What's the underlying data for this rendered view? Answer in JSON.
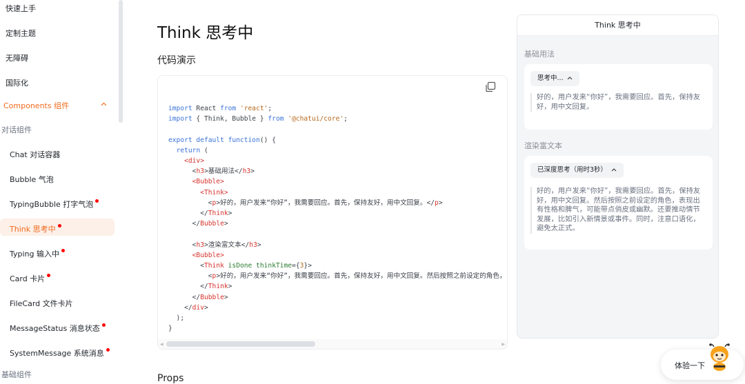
{
  "sidebar": {
    "items_top": [
      "快速上手",
      "定制主题",
      "无障碍",
      "国际化"
    ],
    "components_label": "Components 组件",
    "groups": [
      "对话组件",
      "基础组件"
    ],
    "dialog_items": [
      {
        "label": "Chat 对话容器",
        "dot": false
      },
      {
        "label": "Bubble 气泡",
        "dot": false
      },
      {
        "label": "TypingBubble 打字气泡",
        "dot": true
      },
      {
        "label": "Think 思考中",
        "dot": true,
        "active": true
      },
      {
        "label": "Typing 输入中",
        "dot": true
      },
      {
        "label": "Card 卡片",
        "dot": true
      },
      {
        "label": "FileCard 文件卡片",
        "dot": false
      },
      {
        "label": "MessageStatus 消息状态",
        "dot": true
      },
      {
        "label": "SystemMessage 系统消息",
        "dot": true
      }
    ]
  },
  "main": {
    "title": "Think 思考中",
    "demo_title": "代码演示",
    "props_title": "Props"
  },
  "code": {
    "lines": [
      [
        [
          "kw",
          "import"
        ],
        [
          "pl",
          " React "
        ],
        [
          "kw",
          "from"
        ],
        [
          "pl",
          " "
        ],
        [
          "str",
          "'react'"
        ],
        [
          "pl",
          ";"
        ]
      ],
      [
        [
          "kw",
          "import"
        ],
        [
          "pl",
          " { Think, Bubble } "
        ],
        [
          "kw",
          "from"
        ],
        [
          "pl",
          " "
        ],
        [
          "str",
          "'@chatui/core'"
        ],
        [
          "pl",
          ";"
        ]
      ],
      [],
      [
        [
          "kw",
          "export default function"
        ],
        [
          "pl",
          "() {"
        ]
      ],
      [
        [
          "pl",
          "  "
        ],
        [
          "kw",
          "return"
        ],
        [
          "pl",
          " ("
        ]
      ],
      [
        [
          "pl",
          "    "
        ],
        [
          "tag",
          "<div>"
        ]
      ],
      [
        [
          "pl",
          "      <"
        ],
        [
          "tag",
          "h3"
        ],
        [
          "pl",
          ">基础用法</"
        ],
        [
          "tag",
          "h3"
        ],
        [
          "pl",
          ">"
        ]
      ],
      [
        [
          "pl",
          "      "
        ],
        [
          "tag",
          "<Bubble>"
        ]
      ],
      [
        [
          "pl",
          "        "
        ],
        [
          "tag",
          "<Think>"
        ]
      ],
      [
        [
          "pl",
          "          <"
        ],
        [
          "tag",
          "p"
        ],
        [
          "pl",
          ">好的，用户发来“你好”，我需要回应。首先，保持友好，用中文回复。</"
        ],
        [
          "tag",
          "p"
        ],
        [
          "pl",
          ">"
        ]
      ],
      [
        [
          "pl",
          "        </"
        ],
        [
          "tag",
          "Think"
        ],
        [
          "pl",
          ">"
        ]
      ],
      [
        [
          "pl",
          "      </"
        ],
        [
          "tag",
          "Bubble"
        ],
        [
          "pl",
          ">"
        ]
      ],
      [],
      [
        [
          "pl",
          "      <"
        ],
        [
          "tag",
          "h3"
        ],
        [
          "pl",
          ">渲染富文本</"
        ],
        [
          "tag",
          "h3"
        ],
        [
          "pl",
          ">"
        ]
      ],
      [
        [
          "pl",
          "      "
        ],
        [
          "tag",
          "<Bubble>"
        ]
      ],
      [
        [
          "pl",
          "        <"
        ],
        [
          "tag",
          "Think"
        ],
        [
          "pl",
          " "
        ],
        [
          "attr",
          "isDone"
        ],
        [
          "pl",
          " "
        ],
        [
          "attr",
          "thinkTime"
        ],
        [
          "pl",
          "={"
        ],
        [
          "str",
          "3"
        ],
        [
          "pl",
          "}>"
        ]
      ],
      [
        [
          "pl",
          "          <"
        ],
        [
          "tag",
          "p"
        ],
        [
          "pl",
          ">好的，用户发来“你好”，我需要回应。首先，保持友好，用中文回复。然后按照之前设定的角色，"
        ]
      ],
      [
        [
          "pl",
          "        </"
        ],
        [
          "tag",
          "Think"
        ],
        [
          "pl",
          ">"
        ]
      ],
      [
        [
          "pl",
          "      </"
        ],
        [
          "tag",
          "Bubble"
        ],
        [
          "pl",
          ">"
        ]
      ],
      [
        [
          "pl",
          "    </"
        ],
        [
          "tag",
          "div"
        ],
        [
          "pl",
          ">"
        ]
      ],
      [
        [
          "pl",
          "  );"
        ]
      ],
      [
        [
          "pl",
          "}"
        ]
      ]
    ]
  },
  "preview": {
    "header": "Think 思考中",
    "section1_label": "基础用法",
    "section1_button": "思考中...",
    "section1_text": "好的，用户发来“你好”，我需要回应。首先，保持友好，用中文回复。",
    "section2_label": "渲染富文本",
    "section2_button": "已深度思考（用时3秒）",
    "section2_text": "好的，用户发来“你好”，我需要回应。首先，保持友好，用中文回复。然后按照之前设定的角色，表现出有性格和脾气，可能带点俏皮或幽默。还要推动情节发展，比如引入新情景或事件。同时，注意口语化，避免太正式。"
  },
  "cta": {
    "label": "体验一下"
  },
  "colors": {
    "accent": "#f06a1d",
    "dot": "#ff0000",
    "active_bg": "#fdf0e8"
  },
  "icons": [
    "copy-icon",
    "chevron-up-icon",
    "mascot-icon"
  ]
}
